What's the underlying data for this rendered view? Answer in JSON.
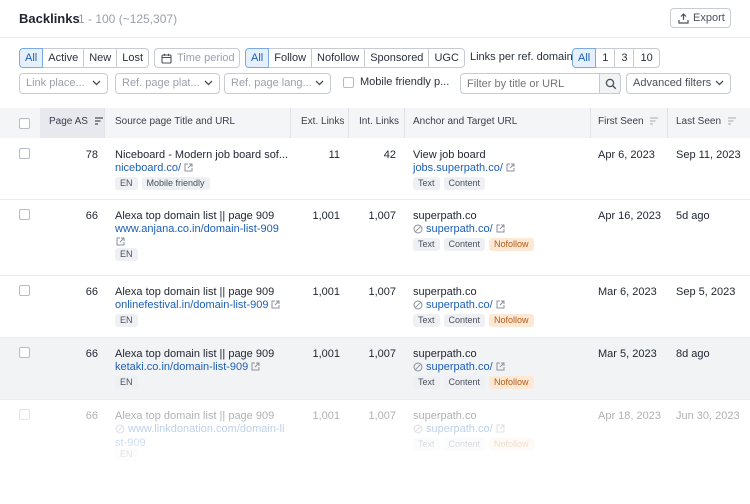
{
  "header": {
    "title": "Backlinks",
    "count": "1 - 100 (~125,307)",
    "export_label": "Export"
  },
  "filters": {
    "status": [
      "All",
      "Active",
      "New",
      "Lost"
    ],
    "time_period": "Time period",
    "link_type": [
      "All",
      "Follow",
      "Nofollow",
      "Sponsored",
      "UGC"
    ],
    "lprd_label": "Links per ref. domain",
    "lprd": [
      "All",
      "1",
      "3",
      "10"
    ],
    "dropdowns": {
      "link_placement": "Link place...",
      "ref_page_platform": "Ref. page plat...",
      "ref_page_language": "Ref. page lang..."
    },
    "mobile_friendly": "Mobile friendly p...",
    "search_placeholder": "Filter by title or URL",
    "advanced_filters": "Advanced filters"
  },
  "columns": {
    "page_as": "Page AS",
    "source": "Source page Title and URL",
    "ext_links": "Ext. Links",
    "int_links": "Int. Links",
    "anchor": "Anchor and Target URL",
    "first_seen": "First Seen",
    "last_seen": "Last Seen"
  },
  "rows": [
    {
      "page_as": "78",
      "title": "Niceboard - Modern job board sof...",
      "url": "niceboard.co/",
      "url2": "",
      "tags": [
        "EN",
        "Mobile friendly"
      ],
      "ext_links": "11",
      "int_links": "42",
      "anchor": "View job board",
      "target": "jobs.superpath.co/",
      "target_nofollow": false,
      "anchor_tags": [
        "Text",
        "Content"
      ],
      "first_seen": "Apr 6, 2023",
      "last_seen": "Sep 11, 2023"
    },
    {
      "page_as": "66",
      "title": "Alexa top domain list || page 909",
      "url": "www.anjana.co.in/domain-list-909",
      "url2": "",
      "tags": [
        "EN"
      ],
      "ext_links": "1,001",
      "int_links": "1,007",
      "anchor": "superpath.co",
      "target": "superpath.co/",
      "target_nofollow": true,
      "anchor_tags": [
        "Text",
        "Content",
        "Nofollow"
      ],
      "first_seen": "Apr 16, 2023",
      "last_seen": "5d ago"
    },
    {
      "page_as": "66",
      "title": "Alexa top domain list || page 909",
      "url": "onlinefestival.in/domain-list-909",
      "url2": "",
      "tags": [
        "EN"
      ],
      "ext_links": "1,001",
      "int_links": "1,007",
      "anchor": "superpath.co",
      "target": "superpath.co/",
      "target_nofollow": true,
      "anchor_tags": [
        "Text",
        "Content",
        "Nofollow"
      ],
      "first_seen": "Mar 6, 2023",
      "last_seen": "Sep 5, 2023"
    },
    {
      "page_as": "66",
      "title": "Alexa top domain list || page 909",
      "url": "ketaki.co.in/domain-list-909",
      "url2": "",
      "tags": [
        "EN"
      ],
      "ext_links": "1,001",
      "int_links": "1,007",
      "anchor": "superpath.co",
      "target": "superpath.co/",
      "target_nofollow": true,
      "anchor_tags": [
        "Text",
        "Content",
        "Nofollow"
      ],
      "first_seen": "Mar 5, 2023",
      "last_seen": "8d ago"
    },
    {
      "page_as": "66",
      "title": "Alexa top domain list || page 909",
      "url": "www.linkdonation.com/domain-li",
      "url2": "st-909",
      "tags": [
        "EN"
      ],
      "ext_links": "1,001",
      "int_links": "1,007",
      "anchor": "superpath.co",
      "target": "superpath.co/",
      "target_nofollow": true,
      "anchor_tags": [
        "Text",
        "Content",
        "Nofollow"
      ],
      "first_seen": "Apr 18, 2023",
      "last_seen": "Jun 30, 2023"
    }
  ]
}
